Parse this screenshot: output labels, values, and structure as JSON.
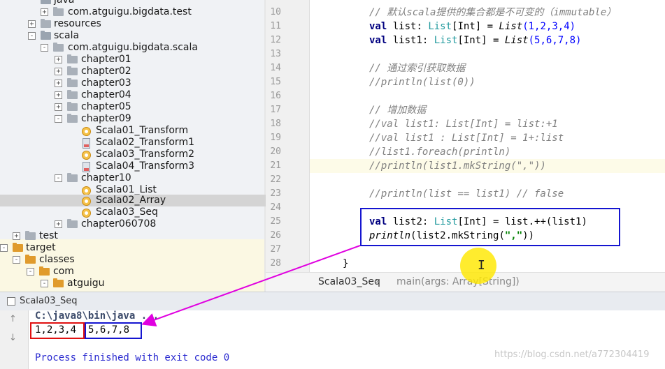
{
  "project_tree": {
    "rows": [
      {
        "label": "java",
        "type": "folder-blue",
        "toggle": "-"
      },
      {
        "label": "com.atguigu.bigdata.test",
        "type": "folder-gray",
        "toggle": "+"
      },
      {
        "label": "resources",
        "type": "folder-gray",
        "toggle": "+"
      },
      {
        "label": "scala",
        "type": "folder-blue",
        "toggle": "-"
      },
      {
        "label": "com.atguigu.bigdata.scala",
        "type": "folder-gray",
        "toggle": "-"
      },
      {
        "label": "chapter01",
        "type": "folder-gray",
        "toggle": "+"
      },
      {
        "label": "chapter02",
        "type": "folder-gray",
        "toggle": "+"
      },
      {
        "label": "chapter03",
        "type": "folder-gray",
        "toggle": "+"
      },
      {
        "label": "chapter04",
        "type": "folder-gray",
        "toggle": "+"
      },
      {
        "label": "chapter05",
        "type": "folder-gray",
        "toggle": "+"
      },
      {
        "label": "chapter09",
        "type": "folder-gray",
        "toggle": "-"
      },
      {
        "label": "Scala01_Transform",
        "type": "object"
      },
      {
        "label": "Scala02_Transform1",
        "type": "file"
      },
      {
        "label": "Scala03_Transform2",
        "type": "object"
      },
      {
        "label": "Scala04_Transform3",
        "type": "file"
      },
      {
        "label": "chapter10",
        "type": "folder-gray",
        "toggle": "-"
      },
      {
        "label": "Scala01_List",
        "type": "object"
      },
      {
        "label": "Scala02_Array",
        "type": "object"
      },
      {
        "label": "Scala03_Seq",
        "type": "object"
      },
      {
        "label": "chapter060708",
        "type": "folder-gray",
        "toggle": "+"
      },
      {
        "label": "test",
        "type": "folder-gray",
        "toggle": "+"
      },
      {
        "label": "target",
        "type": "folder-orange",
        "toggle": "-"
      },
      {
        "label": "classes",
        "type": "folder-orange",
        "toggle": "-"
      },
      {
        "label": "com",
        "type": "folder-orange",
        "toggle": "-"
      },
      {
        "label": "atguigu",
        "type": "folder-orange",
        "toggle": "-"
      }
    ]
  },
  "editor": {
    "line_numbers": [
      "10",
      "11",
      "12",
      "13",
      "14",
      "15",
      "16",
      "17",
      "18",
      "19",
      "20",
      "21",
      "22",
      "23",
      "24",
      "25",
      "26",
      "27",
      "28"
    ],
    "lines": {
      "l10_comment": "// 默认scala提供的集合都是不可变的（immutable）",
      "l11_kw": "val",
      "l11_name": " list: ",
      "l11_type": "List",
      "l11_gen": "[Int] = ",
      "l11_ctor": "List",
      "l11_args": "(1,2,3,4)",
      "l12_kw": "val",
      "l12_name": " list1: ",
      "l12_type": "List",
      "l12_gen": "[Int] = ",
      "l12_ctor": "List",
      "l12_args": "(5,6,7,8)",
      "l14_comment": "// 通过索引获取数据",
      "l15_comment": "//println(list(0))",
      "l17_comment": "// 增加数据",
      "l18_comment": "//val list1: List[Int] = list:+1",
      "l19_comment": "//val list1 : List[Int] = 1+:list",
      "l20_comment": "//list1.foreach(println)",
      "l21_comment": "//println(list1.mkString(\",\"))",
      "l23_comment": "//println(list == list1) // false",
      "l25_kw": "val",
      "l25_name": " list2: ",
      "l25_type": "List",
      "l25_rest": "[Int] = list.++(list1)",
      "l26_fn": "println",
      "l26_open": "(list2.mkString(",
      "l26_str": "\",\"",
      "l26_close": "))",
      "l28_brace": "}"
    }
  },
  "breadcrumb": {
    "file": "Scala03_Seq",
    "separator": "›",
    "method": "main(args: Array[String])"
  },
  "run_panel": {
    "tab_label": "Scala03_Seq",
    "command": "C:\\java8\\bin\\java ...",
    "output_part1": "1,2,3,4",
    "output_part2": "5,6,7,8",
    "exit_message": "Process finished with exit code 0",
    "tool_up": "↑",
    "tool_down": "↓"
  },
  "cursor": {
    "glyph": "I"
  },
  "watermark": "https://blog.csdn.net/a772304419",
  "colors": {
    "annotation_red": "#e01010",
    "annotation_blue": "#1515d0",
    "arrow_magenta": "#e000e0"
  }
}
